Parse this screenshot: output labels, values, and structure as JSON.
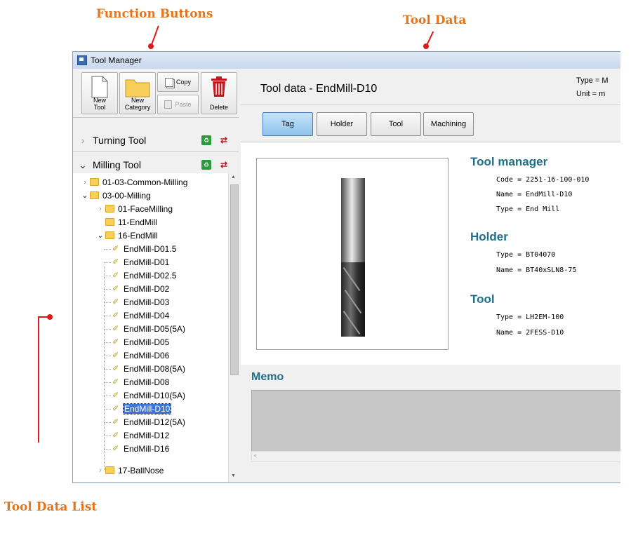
{
  "annotations": {
    "function_buttons": "Function Buttons",
    "tool_data": "Tool Data",
    "tool_data_list": "Tool Data List"
  },
  "window": {
    "title": "Tool Manager"
  },
  "toolbar": {
    "new_tool": "New\nTool",
    "new_category": "New\nCategory",
    "copy": "Copy",
    "paste": "Paste",
    "delete": "Delete"
  },
  "categories": [
    {
      "label": "Turning Tool",
      "expanded": false
    },
    {
      "label": "Milling Tool",
      "expanded": true
    }
  ],
  "tree": {
    "folders": [
      "01-03-Common-Milling",
      "03-00-Milling",
      "01-FaceMilling",
      "11-EndMill",
      "16-EndMill",
      "17-BallNose"
    ],
    "tools": [
      "EndMill-D01.5",
      "EndMill-D01",
      "EndMill-D02.5",
      "EndMill-D02",
      "EndMill-D03",
      "EndMill-D04",
      "EndMill-D05(5A)",
      "EndMill-D05",
      "EndMill-D06",
      "EndMill-D08(5A)",
      "EndMill-D08",
      "EndMill-D10(5A)",
      "EndMill-D10",
      "EndMill-D12(5A)",
      "EndMill-D12",
      "EndMill-D16"
    ],
    "selected": "EndMill-D10"
  },
  "main": {
    "title": "Tool data - EndMill-D10",
    "type_meta": "Type = M",
    "unit_meta": "Unit = m",
    "tabs": [
      "Tag",
      "Holder",
      "Tool",
      "Machining"
    ],
    "active_tab": "Tag"
  },
  "tool_manager": {
    "heading": "Tool manager",
    "code": "Code = 2251-16-100-010",
    "name": "Name = EndMill-D10",
    "type": "Type = End Mill"
  },
  "holder": {
    "heading": "Holder",
    "type": "Type = BT04070",
    "name": "Name = BT40xSLN8-75"
  },
  "tool": {
    "heading": "Tool",
    "type": "Type = LH2EM-100",
    "name": "Name = 2FESS-D10"
  },
  "memo": {
    "heading": "Memo"
  },
  "colors": {
    "annotation": "#e8741a",
    "marker": "#e0181b",
    "heading": "#1f6f8b",
    "selection": "#3875d7"
  }
}
